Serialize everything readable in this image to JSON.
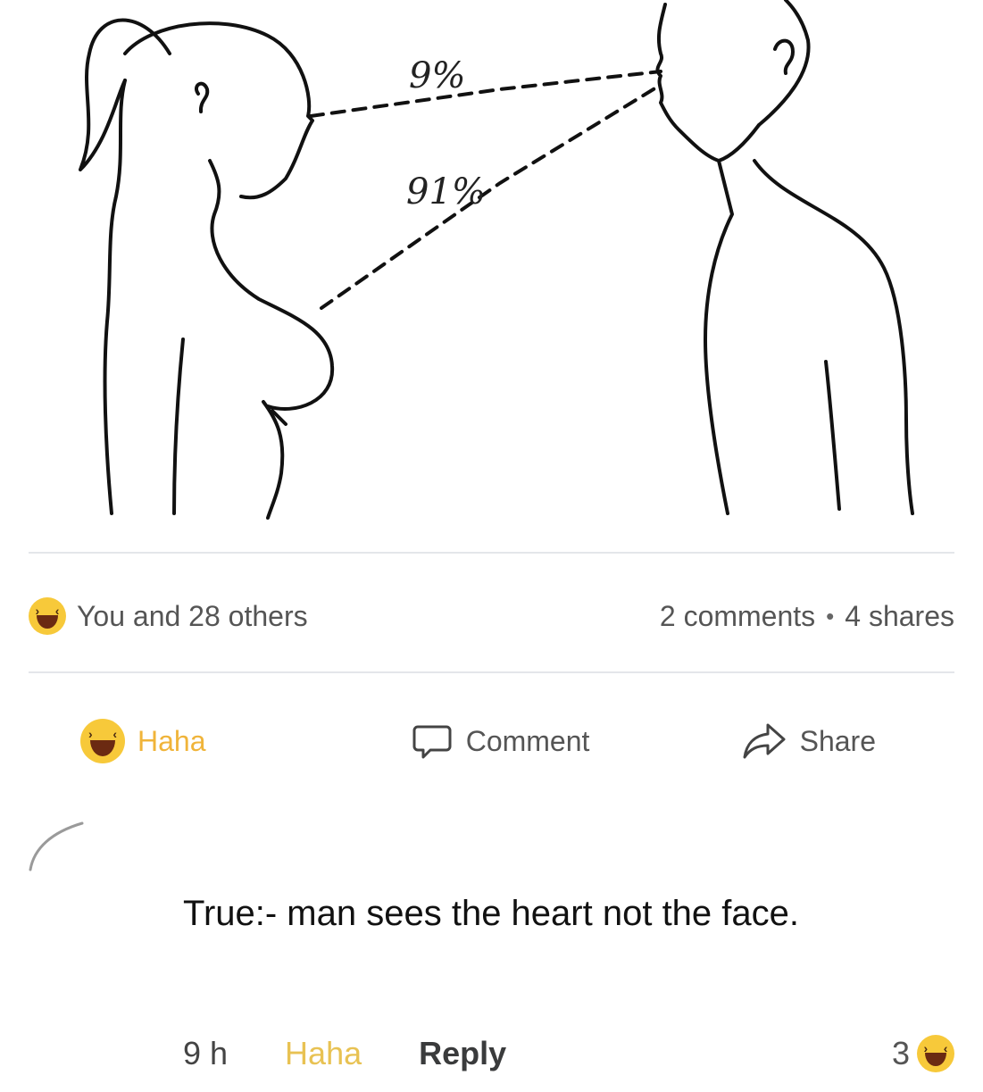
{
  "illustration": {
    "label_face": "9%",
    "label_chest": "91%"
  },
  "post_stats": {
    "reactions_text": "You and 28 others",
    "comments_text": "2 comments",
    "separator": "•",
    "shares_text": "4 shares",
    "reaction_icon": "haha-emoji-icon"
  },
  "actions": {
    "haha_label": "Haha",
    "comment_label": "Comment",
    "share_label": "Share"
  },
  "comment": {
    "text": "True:- man sees the heart not the face.",
    "time": "9 h",
    "haha_label": "Haha",
    "reply_label": "Reply",
    "reaction_count": "3"
  },
  "colors": {
    "haha_yellow": "#f7c93a",
    "haha_label": "#f0b43a",
    "divider": "#e4e6ea"
  }
}
